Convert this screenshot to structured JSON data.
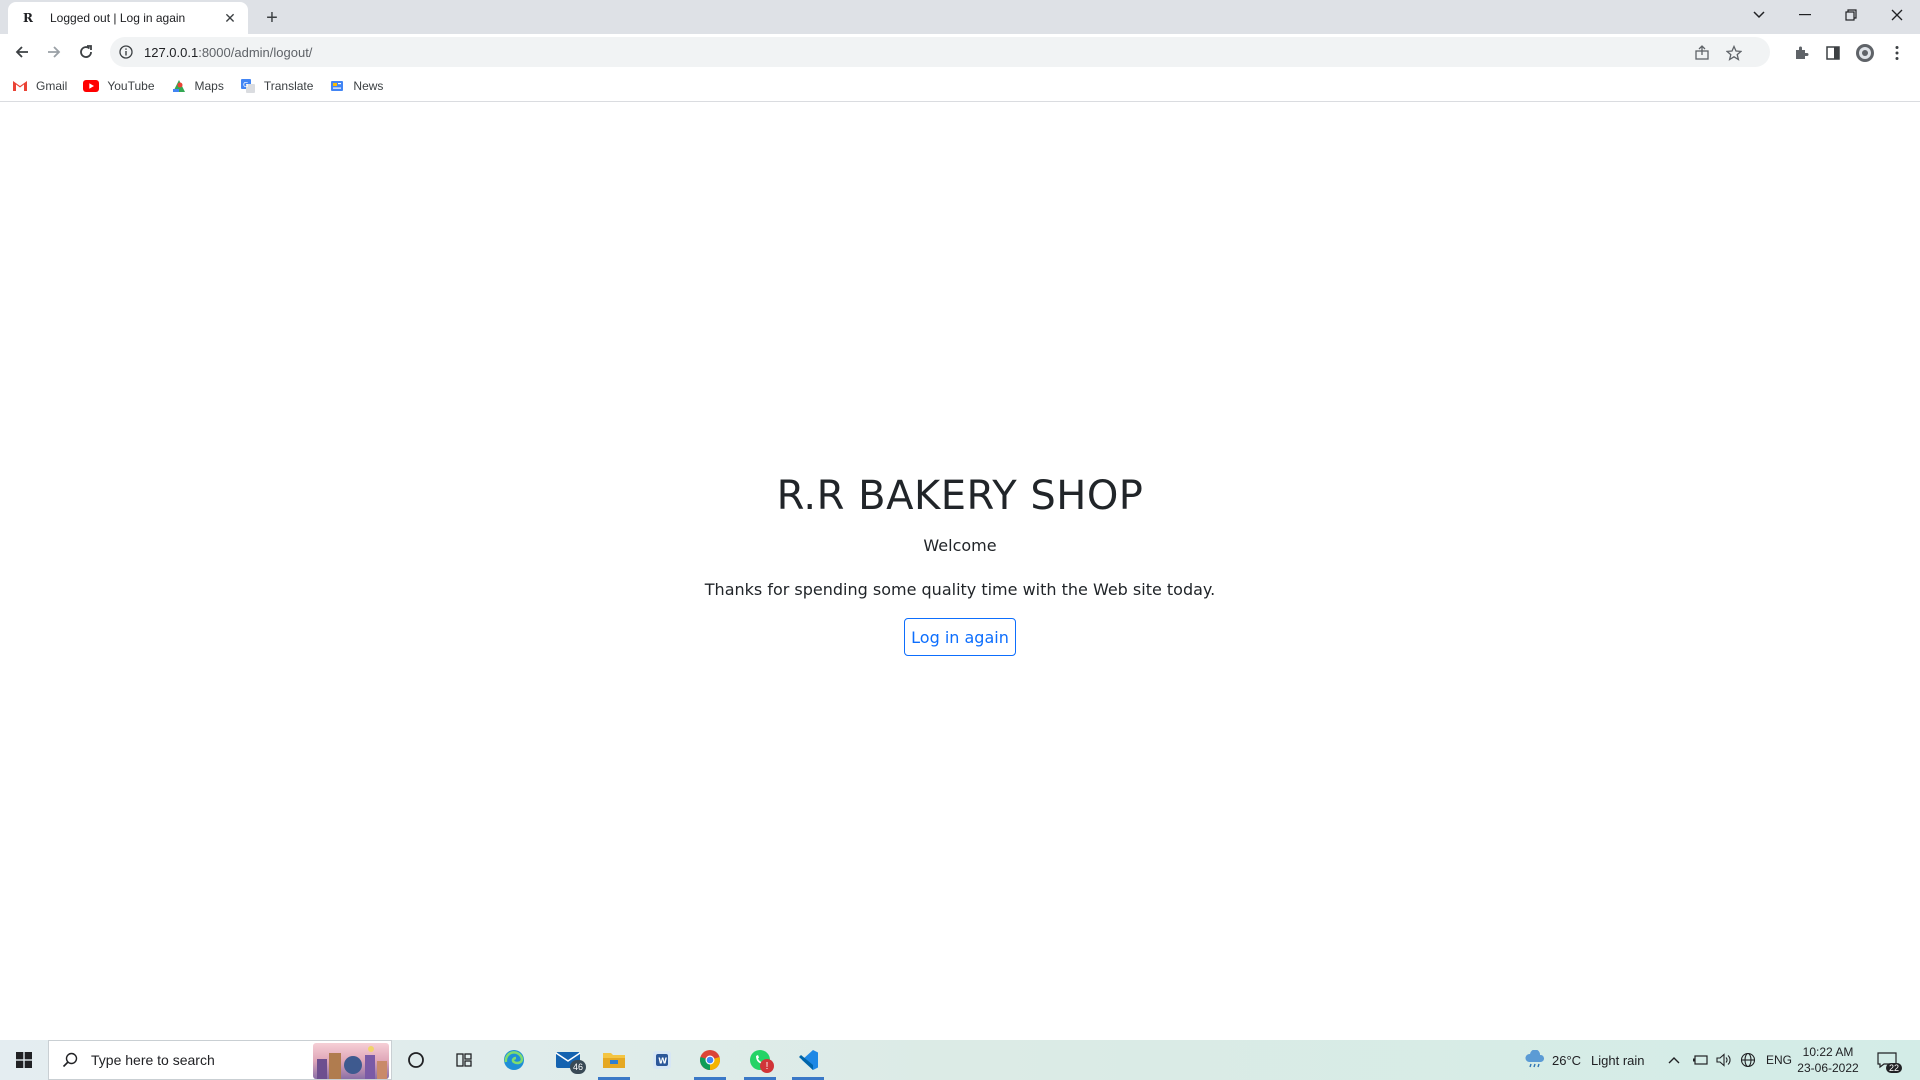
{
  "tab": {
    "favicon": "R",
    "title": "Logged out | Log in again",
    "close": "✕",
    "new_tab": "+"
  },
  "toolbar": {
    "url_host": "127.0.0.1",
    "url_rest": ":8000/admin/logout/"
  },
  "bookmarks": [
    {
      "label": "Gmail",
      "icon": "gmail-icon",
      "color": "#ea4335"
    },
    {
      "label": "YouTube",
      "icon": "youtube-icon",
      "color": "#ff0000"
    },
    {
      "label": "Maps",
      "icon": "maps-icon",
      "color": "#34a853"
    },
    {
      "label": "Translate",
      "icon": "translate-icon",
      "color": "#4285f4"
    },
    {
      "label": "News",
      "icon": "news-icon",
      "color": "#4285f4"
    }
  ],
  "page": {
    "title": "R.R BAKERY SHOP",
    "welcome": "Welcome",
    "message": "Thanks for spending some quality time with the Web site today.",
    "login_button": "Log in again",
    "accent_color": "#0d6efd"
  },
  "taskbar": {
    "search_placeholder": "Type here to search",
    "mail_badge": "46",
    "whatsapp_badge": "!",
    "weather_temp": "26°C",
    "weather_desc": "Light rain",
    "language": "ENG",
    "time": "10:22 AM",
    "date": "23-06-2022",
    "notifications_count": "22"
  }
}
